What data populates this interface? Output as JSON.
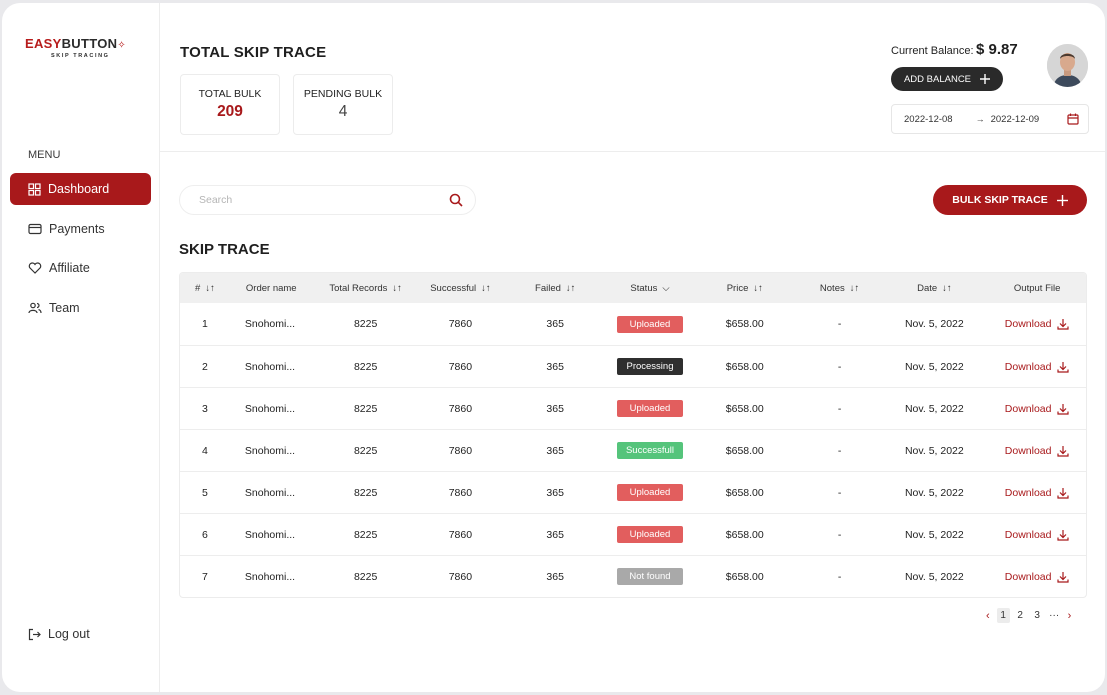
{
  "brand": {
    "logo_part1": "EASY",
    "logo_part2": "BUTTON",
    "logo_sub": "SKIP TRACING"
  },
  "sidebar": {
    "menu_title": "MENU",
    "items": [
      {
        "label": "Dashboard",
        "icon": "grid-icon",
        "active": true
      },
      {
        "label": "Payments",
        "icon": "credit-card-icon"
      },
      {
        "label": "Affiliate",
        "icon": "heart-icon"
      },
      {
        "label": "Team",
        "icon": "users-icon"
      }
    ],
    "logout_label": "Log out"
  },
  "header": {
    "title": "TOTAL SKIP TRACE",
    "stats": [
      {
        "label": "TOTAL BULK",
        "value": "209"
      },
      {
        "label": "PENDING BULK",
        "value": "4"
      }
    ],
    "balance_label": "Current Balance:",
    "balance_value": "$ 9.87",
    "add_balance_label": "ADD BALANCE",
    "date_from": "2022-12-08",
    "date_arrow": "→",
    "date_to": "2022-12-09"
  },
  "toolbar": {
    "search_placeholder": "Search",
    "bulk_button_label": "BULK SKIP TRACE"
  },
  "table": {
    "title": "SKIP TRACE",
    "columns": [
      "#",
      "Order name",
      "Total Records",
      "Successful",
      "Failed",
      "Status",
      "Price",
      "Notes",
      "Date",
      "Output File"
    ],
    "rows": [
      {
        "num": "1",
        "order": "Snohomi...",
        "total": "8225",
        "success": "7860",
        "failed": "365",
        "status": "Uploaded",
        "price": "$658.00",
        "notes": "-",
        "date": "Nov. 5, 2022",
        "output": "Download"
      },
      {
        "num": "2",
        "order": "Snohomi...",
        "total": "8225",
        "success": "7860",
        "failed": "365",
        "status": "Processing",
        "price": "$658.00",
        "notes": "-",
        "date": "Nov. 5, 2022",
        "output": "Download"
      },
      {
        "num": "3",
        "order": "Snohomi...",
        "total": "8225",
        "success": "7860",
        "failed": "365",
        "status": "Uploaded",
        "price": "$658.00",
        "notes": "-",
        "date": "Nov. 5, 2022",
        "output": "Download"
      },
      {
        "num": "4",
        "order": "Snohomi...",
        "total": "8225",
        "success": "7860",
        "failed": "365",
        "status": "Successfull",
        "price": "$658.00",
        "notes": "-",
        "date": "Nov. 5, 2022",
        "output": "Download"
      },
      {
        "num": "5",
        "order": "Snohomi...",
        "total": "8225",
        "success": "7860",
        "failed": "365",
        "status": "Uploaded",
        "price": "$658.00",
        "notes": "-",
        "date": "Nov. 5, 2022",
        "output": "Download"
      },
      {
        "num": "6",
        "order": "Snohomi...",
        "total": "8225",
        "success": "7860",
        "failed": "365",
        "status": "Uploaded",
        "price": "$658.00",
        "notes": "-",
        "date": "Nov. 5, 2022",
        "output": "Download"
      },
      {
        "num": "7",
        "order": "Snohomi...",
        "total": "8225",
        "success": "7860",
        "failed": "365",
        "status": "Not found",
        "price": "$658.00",
        "notes": "-",
        "date": "Nov. 5, 2022",
        "output": "Download"
      }
    ]
  },
  "pagination": {
    "pages": [
      "1",
      "2",
      "3"
    ],
    "ellipsis": "···",
    "current": "1"
  },
  "colors": {
    "accent": "#a8191b",
    "uploaded": "#e25e5e",
    "processing": "#2f2f2f",
    "successfull": "#55c47b",
    "not_found": "#a9a9a9"
  }
}
